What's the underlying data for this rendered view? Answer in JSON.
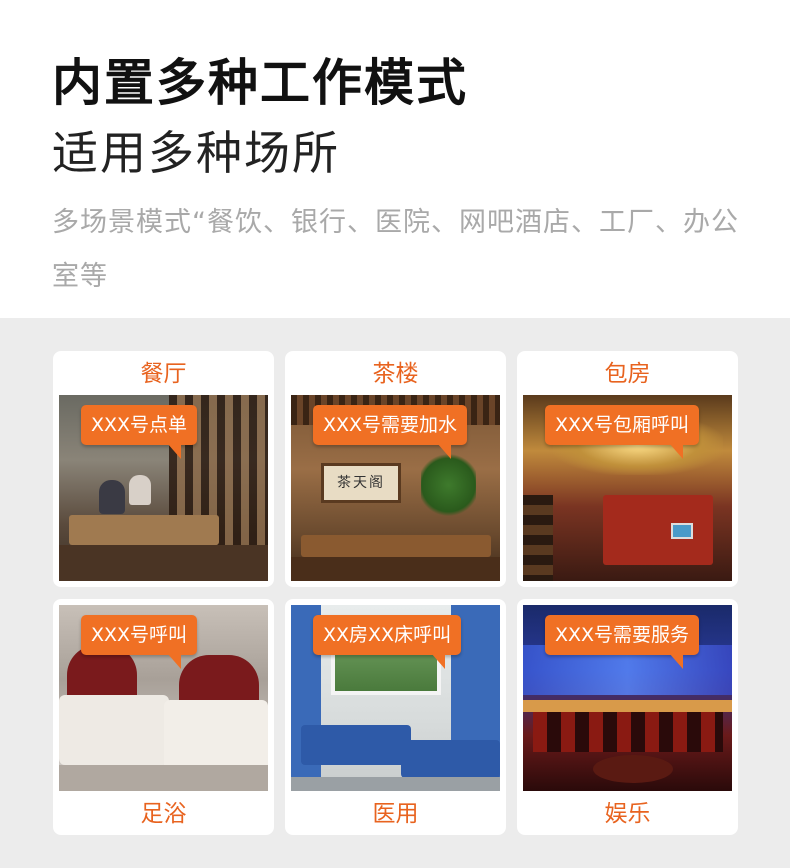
{
  "header": {
    "title": "内置多种工作模式",
    "subtitle": "适用多种场所",
    "description": "多场景模式“餐饮、银行、医院、网吧酒店、工厂、办公室等"
  },
  "scenes": [
    {
      "label": "餐厅",
      "call_text": "XXX号点单"
    },
    {
      "label": "茶楼",
      "call_text": "XXX号需要加水",
      "sign_text": "茶天阁"
    },
    {
      "label": "包房",
      "call_text": "XXX号包厢呼叫"
    },
    {
      "label": "足浴",
      "call_text": "XXX号呼叫"
    },
    {
      "label": "医用",
      "call_text": "XX房XX床呼叫"
    },
    {
      "label": "娱乐",
      "call_text": "XXX号需要服务"
    }
  ],
  "colors": {
    "accent": "#f07024",
    "label": "#e8631f",
    "background": "#ececec"
  }
}
